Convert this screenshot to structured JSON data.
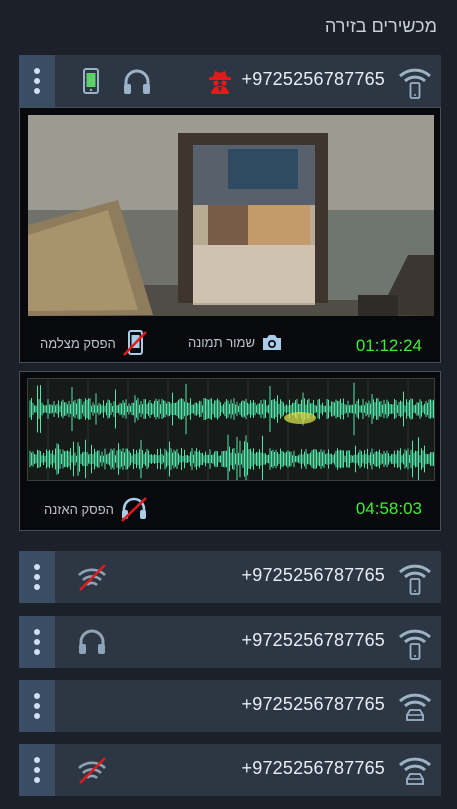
{
  "panel_title": "מכשירים בזירה",
  "active_device": {
    "phone": "+9725256787765",
    "camera": {
      "timer": "01:12:24",
      "save_photo_label": "שמור תמונה",
      "stop_camera_label": "הפסק מצלמה"
    },
    "audio": {
      "timer": "04:58:03",
      "stop_listening_label": "הפסק האזנה"
    }
  },
  "devices": [
    {
      "phone": "+9725256787765",
      "status_icon": "wifi-off-icon",
      "conn_icon": "wifi-phone-icon"
    },
    {
      "phone": "+9725256787765",
      "status_icon": "headphones-icon",
      "conn_icon": "wifi-phone-icon"
    },
    {
      "phone": "+9725256787765",
      "status_icon": "",
      "conn_icon": "wifi-car-icon"
    },
    {
      "phone": "+9725256787765",
      "status_icon": "wifi-off-icon",
      "conn_icon": "wifi-car-icon"
    }
  ],
  "colors": {
    "background": "#1c2129",
    "bar": "#2d3743",
    "menu": "#3b4d62",
    "timer": "#3df02f",
    "alert": "#e01b1b",
    "waveform": "#52e6a8"
  }
}
